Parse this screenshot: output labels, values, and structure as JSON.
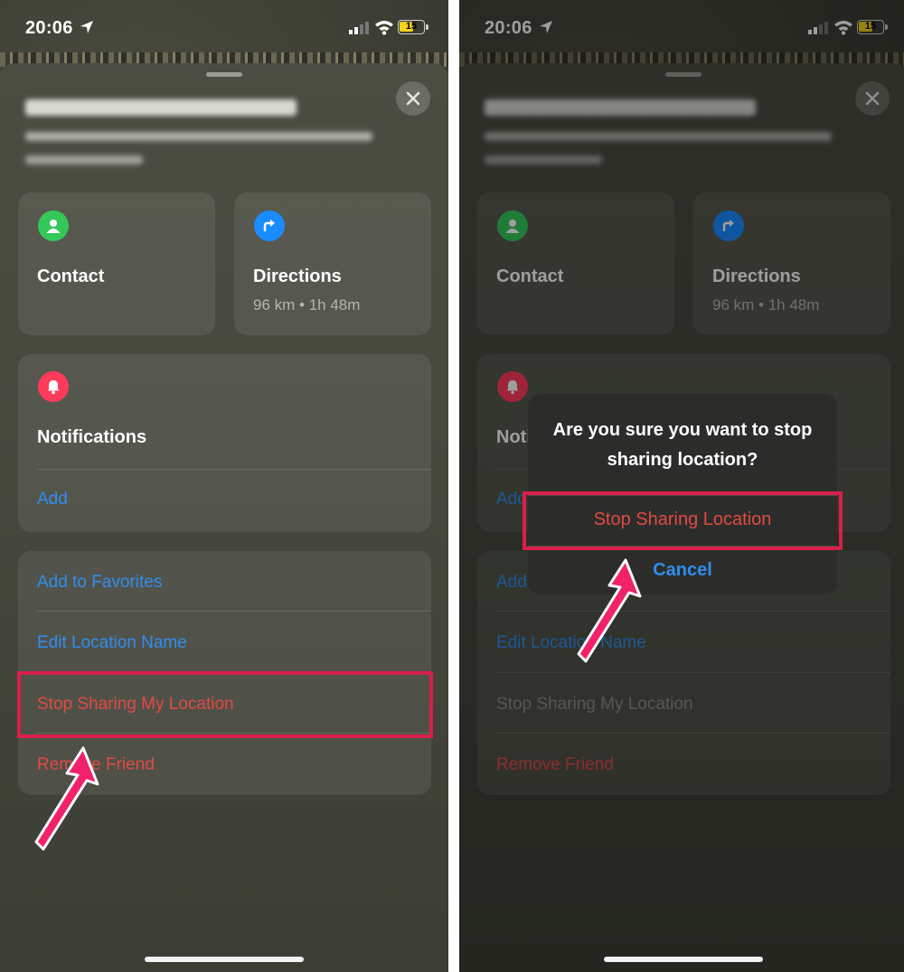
{
  "status_bar": {
    "time": "20:06",
    "battery": "15"
  },
  "actions": {
    "contact": {
      "label": "Contact"
    },
    "directions": {
      "label": "Directions",
      "detail": "96 km • 1h 48m"
    }
  },
  "notifications": {
    "title": "Notifications",
    "add_label": "Add"
  },
  "menu": {
    "add_favorites": "Add to Favorites",
    "edit_location_name": "Edit Location Name",
    "stop_sharing": "Stop Sharing My Location",
    "remove_friend": "Remove Friend"
  },
  "alert": {
    "message": "Are you sure you want to stop sharing location?",
    "confirm": "Stop Sharing Location",
    "cancel": "Cancel"
  },
  "colors": {
    "accent_blue": "#2f8ef0",
    "destructive_red": "#e04a43",
    "highlight": "#d91f4a",
    "contact_icon": "#34c759",
    "directions_icon": "#1a8cff",
    "notifications_icon": "#ff3b5c"
  },
  "icons": [
    "location-arrow-icon",
    "signal-icon",
    "wifi-icon",
    "battery-icon",
    "close-icon",
    "person-icon",
    "turn-right-arrow-icon",
    "bell-icon",
    "pointer-arrow-icon"
  ]
}
